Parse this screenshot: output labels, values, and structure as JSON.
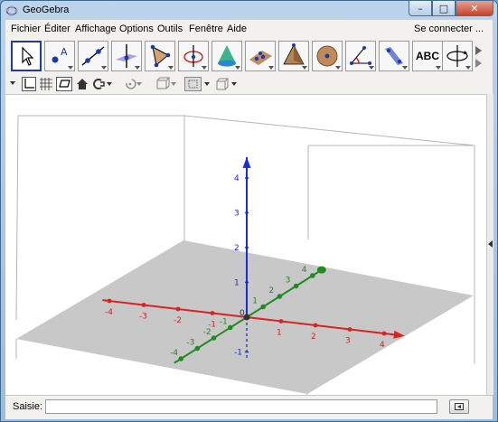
{
  "window": {
    "title": "GeoGebra",
    "minimize": "–",
    "maximize": "□",
    "close": "✕"
  },
  "menubar": {
    "items": [
      "Fichier",
      "Éditer",
      "Affichage",
      "Options",
      "Outils",
      "Fenêtre",
      "Aide"
    ],
    "signin": "Se connecter ..."
  },
  "toolbar": {
    "tools": [
      "move-tool-icon",
      "point-tool-icon",
      "line-tool-icon",
      "perpendicular-line-tool-icon",
      "polygon-tool-icon",
      "circle-tool-icon",
      "intersect-planes-tool-icon",
      "pyramid-tool-icon",
      "plane-tool-icon",
      "sphere-tool-icon",
      "angle-tool-icon",
      "reflect-tool-icon",
      "distance-tool-icon",
      "text-tool-icon",
      "rotate-view-tool-icon"
    ],
    "text_tool_label": "ABC"
  },
  "graphics": {
    "x_ticks": [
      "-4",
      "-3",
      "-2",
      "-1",
      "0",
      "1",
      "2",
      "3",
      "4"
    ],
    "y_ticks": [
      "-4",
      "-3",
      "-2",
      "-1",
      "1",
      "2",
      "3",
      "4"
    ],
    "z_ticks": [
      "-1",
      "1",
      "2",
      "3",
      "4"
    ],
    "origin_label": "0",
    "colors": {
      "x_axis": "#d92222",
      "y_axis": "#1e8c1e",
      "z_axis": "#1c2bd6",
      "plane": "#c8c8c8"
    }
  },
  "inputbar": {
    "label": "Saisie:",
    "value": ""
  }
}
